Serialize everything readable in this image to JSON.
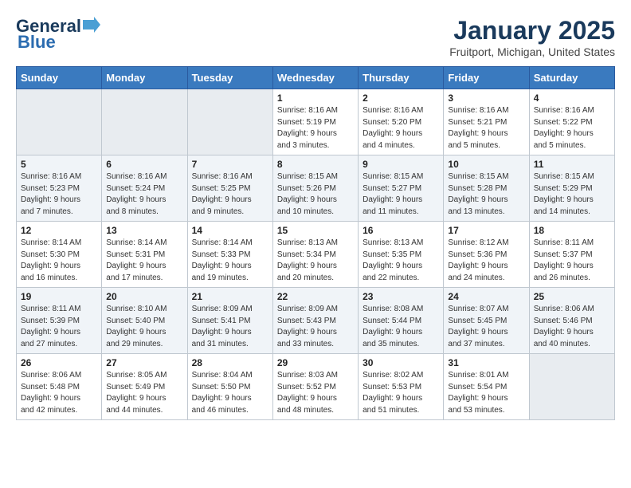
{
  "logo": {
    "line1": "General",
    "line2": "Blue"
  },
  "header": {
    "title": "January 2025",
    "location": "Fruitport, Michigan, United States"
  },
  "days_of_week": [
    "Sunday",
    "Monday",
    "Tuesday",
    "Wednesday",
    "Thursday",
    "Friday",
    "Saturday"
  ],
  "weeks": [
    [
      {
        "day": "",
        "info": ""
      },
      {
        "day": "",
        "info": ""
      },
      {
        "day": "",
        "info": ""
      },
      {
        "day": "1",
        "info": "Sunrise: 8:16 AM\nSunset: 5:19 PM\nDaylight: 9 hours\nand 3 minutes."
      },
      {
        "day": "2",
        "info": "Sunrise: 8:16 AM\nSunset: 5:20 PM\nDaylight: 9 hours\nand 4 minutes."
      },
      {
        "day": "3",
        "info": "Sunrise: 8:16 AM\nSunset: 5:21 PM\nDaylight: 9 hours\nand 5 minutes."
      },
      {
        "day": "4",
        "info": "Sunrise: 8:16 AM\nSunset: 5:22 PM\nDaylight: 9 hours\nand 5 minutes."
      }
    ],
    [
      {
        "day": "5",
        "info": "Sunrise: 8:16 AM\nSunset: 5:23 PM\nDaylight: 9 hours\nand 7 minutes."
      },
      {
        "day": "6",
        "info": "Sunrise: 8:16 AM\nSunset: 5:24 PM\nDaylight: 9 hours\nand 8 minutes."
      },
      {
        "day": "7",
        "info": "Sunrise: 8:16 AM\nSunset: 5:25 PM\nDaylight: 9 hours\nand 9 minutes."
      },
      {
        "day": "8",
        "info": "Sunrise: 8:15 AM\nSunset: 5:26 PM\nDaylight: 9 hours\nand 10 minutes."
      },
      {
        "day": "9",
        "info": "Sunrise: 8:15 AM\nSunset: 5:27 PM\nDaylight: 9 hours\nand 11 minutes."
      },
      {
        "day": "10",
        "info": "Sunrise: 8:15 AM\nSunset: 5:28 PM\nDaylight: 9 hours\nand 13 minutes."
      },
      {
        "day": "11",
        "info": "Sunrise: 8:15 AM\nSunset: 5:29 PM\nDaylight: 9 hours\nand 14 minutes."
      }
    ],
    [
      {
        "day": "12",
        "info": "Sunrise: 8:14 AM\nSunset: 5:30 PM\nDaylight: 9 hours\nand 16 minutes."
      },
      {
        "day": "13",
        "info": "Sunrise: 8:14 AM\nSunset: 5:31 PM\nDaylight: 9 hours\nand 17 minutes."
      },
      {
        "day": "14",
        "info": "Sunrise: 8:14 AM\nSunset: 5:33 PM\nDaylight: 9 hours\nand 19 minutes."
      },
      {
        "day": "15",
        "info": "Sunrise: 8:13 AM\nSunset: 5:34 PM\nDaylight: 9 hours\nand 20 minutes."
      },
      {
        "day": "16",
        "info": "Sunrise: 8:13 AM\nSunset: 5:35 PM\nDaylight: 9 hours\nand 22 minutes."
      },
      {
        "day": "17",
        "info": "Sunrise: 8:12 AM\nSunset: 5:36 PM\nDaylight: 9 hours\nand 24 minutes."
      },
      {
        "day": "18",
        "info": "Sunrise: 8:11 AM\nSunset: 5:37 PM\nDaylight: 9 hours\nand 26 minutes."
      }
    ],
    [
      {
        "day": "19",
        "info": "Sunrise: 8:11 AM\nSunset: 5:39 PM\nDaylight: 9 hours\nand 27 minutes."
      },
      {
        "day": "20",
        "info": "Sunrise: 8:10 AM\nSunset: 5:40 PM\nDaylight: 9 hours\nand 29 minutes."
      },
      {
        "day": "21",
        "info": "Sunrise: 8:09 AM\nSunset: 5:41 PM\nDaylight: 9 hours\nand 31 minutes."
      },
      {
        "day": "22",
        "info": "Sunrise: 8:09 AM\nSunset: 5:43 PM\nDaylight: 9 hours\nand 33 minutes."
      },
      {
        "day": "23",
        "info": "Sunrise: 8:08 AM\nSunset: 5:44 PM\nDaylight: 9 hours\nand 35 minutes."
      },
      {
        "day": "24",
        "info": "Sunrise: 8:07 AM\nSunset: 5:45 PM\nDaylight: 9 hours\nand 37 minutes."
      },
      {
        "day": "25",
        "info": "Sunrise: 8:06 AM\nSunset: 5:46 PM\nDaylight: 9 hours\nand 40 minutes."
      }
    ],
    [
      {
        "day": "26",
        "info": "Sunrise: 8:06 AM\nSunset: 5:48 PM\nDaylight: 9 hours\nand 42 minutes."
      },
      {
        "day": "27",
        "info": "Sunrise: 8:05 AM\nSunset: 5:49 PM\nDaylight: 9 hours\nand 44 minutes."
      },
      {
        "day": "28",
        "info": "Sunrise: 8:04 AM\nSunset: 5:50 PM\nDaylight: 9 hours\nand 46 minutes."
      },
      {
        "day": "29",
        "info": "Sunrise: 8:03 AM\nSunset: 5:52 PM\nDaylight: 9 hours\nand 48 minutes."
      },
      {
        "day": "30",
        "info": "Sunrise: 8:02 AM\nSunset: 5:53 PM\nDaylight: 9 hours\nand 51 minutes."
      },
      {
        "day": "31",
        "info": "Sunrise: 8:01 AM\nSunset: 5:54 PM\nDaylight: 9 hours\nand 53 minutes."
      },
      {
        "day": "",
        "info": ""
      }
    ]
  ]
}
